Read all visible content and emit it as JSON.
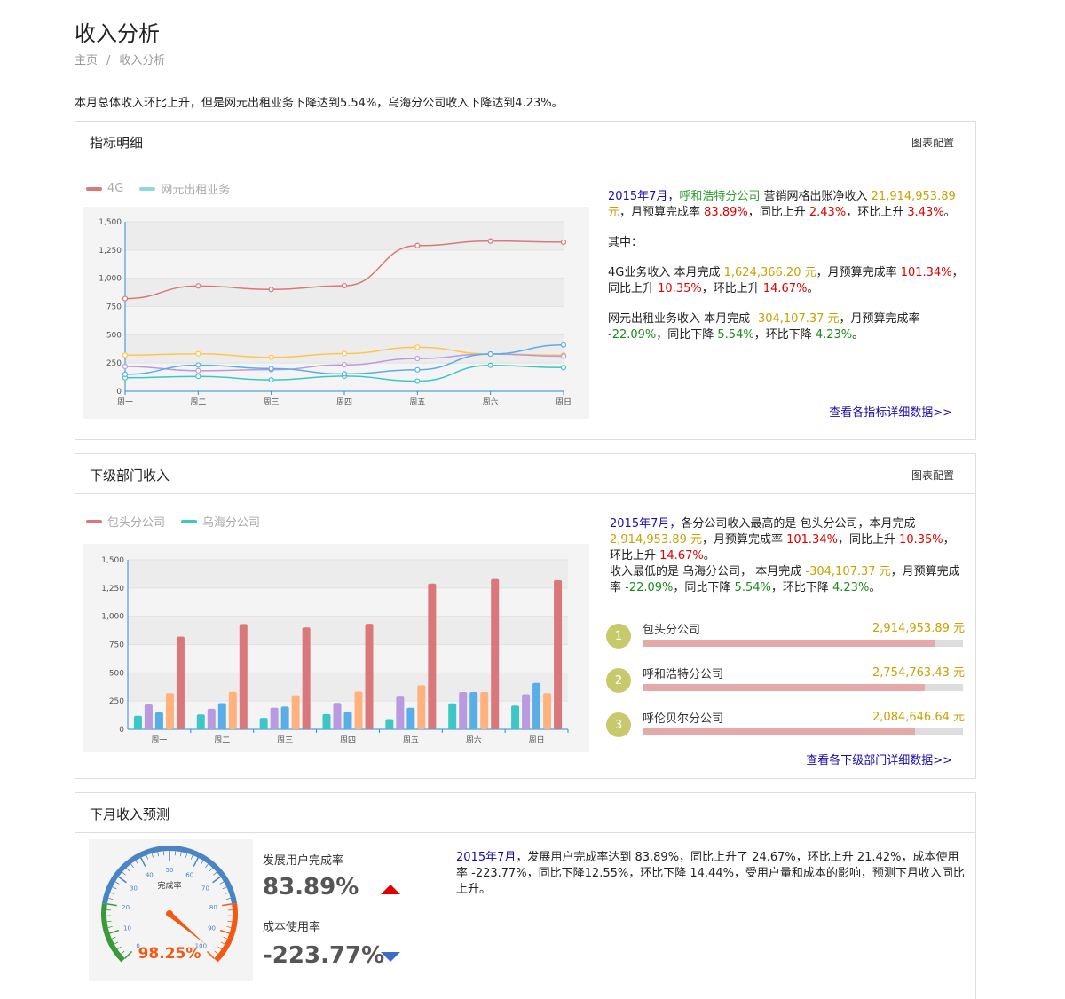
{
  "page": {
    "title": "收入分析"
  },
  "breadcrumb": {
    "home": "主页",
    "sep": "/",
    "current": "收入分析"
  },
  "summary": "本月总体收入环比上升，但是网元出租业务下降达到5.54%，乌海分公司收入下降达到4.23%。",
  "panel1": {
    "title": "指标明细",
    "config": "图表配置",
    "legend": [
      {
        "name": "4G",
        "color": "#d9777b"
      },
      {
        "name": "网元出租业务",
        "color": "#8fdad8"
      }
    ],
    "info": {
      "p1": {
        "period": "2015年7月，",
        "company": "呼和浩特分公司",
        "metric": " 营销网格出账净收入 ",
        "amount": "21,914,953.89 元",
        "t1": "，月预算完成率 ",
        "rate": "83.89%",
        "t2": "，同比上升 ",
        "yoy": "2.43%",
        "t3": "，环比上升 ",
        "mom": "3.43%",
        "t4": "。"
      },
      "p2": "其中：",
      "p3": {
        "t0": "4G业务收入 本月完成 ",
        "amount": "1,624,366.20 元",
        "t1": "，月预算完成率 ",
        "rate": "101.34%",
        "t2": "，同比上升 ",
        "yoy": "10.35%",
        "t3": "，环比上升 ",
        "mom": "14.67%",
        "t4": "。"
      },
      "p4": {
        "t0": "网元出租业务收入 本月完成 ",
        "amount": "-304,107.37 元",
        "t1": "，月预算完成率 ",
        "rate": "-22.09%",
        "t2": "，同比下降 ",
        "yoy": "5.54%",
        "t3": "，环比下降 ",
        "mom": "4.23%",
        "t4": "。"
      }
    },
    "link": "查看各指标详细数据>>"
  },
  "panel2": {
    "title": "下级部门收入",
    "config": "图表配置",
    "legend": [
      {
        "name": "包头分公司",
        "color": "#d9777b"
      },
      {
        "name": "乌海分公司",
        "color": "#3ec6c6"
      }
    ],
    "info": {
      "l1": {
        "period": "2015年7月，",
        "t0": "各分公司收入最高的是 包头分公司，本月完成 ",
        "amount": "2,914,953.89 元",
        "t1": "，月预算完成率 ",
        "rate": "101.34%",
        "t2": "，同比上升 ",
        "yoy": "10.35%",
        "t3": "，环比上升 ",
        "mom": "14.67%",
        "t4": "。"
      },
      "l2": {
        "t0": "收入最低的是 乌海分公司， 本月完成 ",
        "amount": "-304,107.37 元",
        "t1": "，月预算完成率 ",
        "rate": "-22.09%",
        "t2": "，同比下降 ",
        "yoy": "5.54%",
        "t3": "，环比下降 ",
        "mom": "4.23%",
        "t4": "。"
      }
    },
    "ranking": [
      {
        "rank": "1",
        "name": "包头分公司",
        "value": "2,914,953.89 元",
        "fill": 0.91
      },
      {
        "rank": "2",
        "name": "呼和浩特分公司",
        "value": "2,754,763.43 元",
        "fill": 0.88
      },
      {
        "rank": "3",
        "name": "呼伦贝尔分公司",
        "value": "2,084,646.64 元",
        "fill": 0.85
      }
    ],
    "link": "查看各下级部门详细数据>>"
  },
  "panel3": {
    "title": "下月收入预测",
    "kpi1": {
      "label": "发展用户完成率",
      "value": "83.89%",
      "trend": "up"
    },
    "kpi2": {
      "label": "成本使用率",
      "value": "-223.77%",
      "trend": "down"
    },
    "gauge": {
      "title": "完成率",
      "value": 98.25,
      "display": "98.25%",
      "ticks": [
        "0",
        "10",
        "20",
        "30",
        "40",
        "50",
        "60",
        "70",
        "80",
        "90",
        "100"
      ]
    },
    "text": {
      "period": "2015年7月",
      "body": "，发展用户完成率达到 83.89%，同比上升了 24.67%，环比上升 21.42%，成本使用率 -223.77%，同比下降12.55%，环比下降 14.44%，受用户量和成本的影响，预测下月收入同比上升。"
    }
  },
  "chart_data": [
    {
      "type": "line",
      "categories": [
        "周一",
        "周二",
        "周三",
        "周四",
        "周五",
        "周六",
        "周日"
      ],
      "ylim": [
        0,
        1500
      ],
      "yticks": [
        "0",
        "250",
        "500",
        "750",
        "1,000",
        "1,250",
        "1,500"
      ],
      "series": [
        {
          "name": "4G",
          "color": "#d9777b",
          "values": [
            820,
            932,
            901,
            934,
            1290,
            1330,
            1320
          ]
        },
        {
          "name": "网元出租业务",
          "color": "#3ec6c6",
          "values": [
            120,
            132,
            101,
            134,
            90,
            230,
            210
          ]
        },
        {
          "color": "#ffc64d",
          "values": [
            320,
            332,
            301,
            334,
            390,
            330,
            320
          ]
        },
        {
          "color": "#b99ae0",
          "values": [
            220,
            182,
            191,
            234,
            290,
            330,
            310
          ]
        },
        {
          "color": "#5aaee8",
          "values": [
            150,
            232,
            201,
            154,
            190,
            330,
            410
          ]
        }
      ]
    },
    {
      "type": "bar",
      "categories": [
        "周一",
        "周二",
        "周三",
        "周四",
        "周五",
        "周六",
        "周日"
      ],
      "ylim": [
        0,
        1500
      ],
      "yticks": [
        "0",
        "250",
        "500",
        "750",
        "1,000",
        "1,250",
        "1,500"
      ],
      "series": [
        {
          "name": "乌海分公司",
          "color": "#3ec6c6",
          "values": [
            120,
            132,
            101,
            134,
            90,
            230,
            210
          ]
        },
        {
          "color": "#b99ae0",
          "values": [
            220,
            182,
            191,
            234,
            290,
            330,
            310
          ]
        },
        {
          "color": "#5aaee8",
          "values": [
            150,
            232,
            201,
            154,
            190,
            330,
            410
          ]
        },
        {
          "color": "#ffb27d",
          "values": [
            320,
            332,
            301,
            334,
            390,
            330,
            320
          ]
        },
        {
          "name": "包头分公司",
          "color": "#d9777b",
          "values": [
            820,
            932,
            901,
            934,
            1290,
            1330,
            1320
          ]
        }
      ]
    }
  ]
}
